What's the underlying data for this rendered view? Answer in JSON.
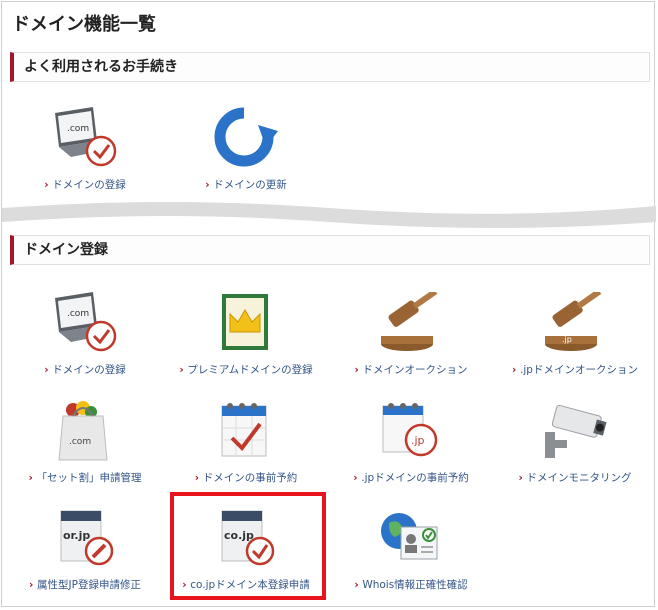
{
  "page": {
    "title": "ドメイン機能一覧"
  },
  "sections": {
    "frequent": {
      "title": "よく利用されるお手続き",
      "items": [
        {
          "label": "ドメインの登録",
          "icon": "laptop-com-check-icon",
          "icon_text": ".com"
        },
        {
          "label": "ドメインの更新",
          "icon": "refresh-arrow-icon"
        }
      ]
    },
    "registration": {
      "title": "ドメイン登録",
      "items": [
        {
          "label": "ドメインの登録",
          "icon": "laptop-com-check-icon",
          "icon_text": ".com"
        },
        {
          "label": "プレミアムドメインの登録",
          "icon": "premium-crown-icon"
        },
        {
          "label": "ドメインオークション",
          "icon": "auction-gavel-icon"
        },
        {
          "label": ".jpドメインオークション",
          "icon": "jp-auction-gavel-icon",
          "icon_text": ".jp"
        },
        {
          "label": "「セット割」申請管理",
          "icon": "shopping-bag-icon",
          "icon_text": ".com"
        },
        {
          "label": "ドメインの事前予約",
          "icon": "calendar-check-icon"
        },
        {
          "label": ".jpドメインの事前予約",
          "icon": "calendar-jp-icon",
          "icon_text": ".jp"
        },
        {
          "label": "ドメインモニタリング",
          "icon": "security-camera-icon"
        },
        {
          "label": "属性型JP登録申請修正",
          "icon": "orjp-document-edit-icon",
          "icon_text": "or.jp"
        },
        {
          "label": "co.jpドメイン本登録申請",
          "icon": "cojp-document-check-icon",
          "icon_text": "co.jp"
        },
        {
          "label": "Whois情報正確性確認",
          "icon": "whois-globe-idcard-icon"
        }
      ]
    }
  },
  "colors": {
    "accent": "#a1182a",
    "link": "#335588",
    "highlight": "#e8141c",
    "check": "#c0392b",
    "refresh": "#2a73c8"
  }
}
